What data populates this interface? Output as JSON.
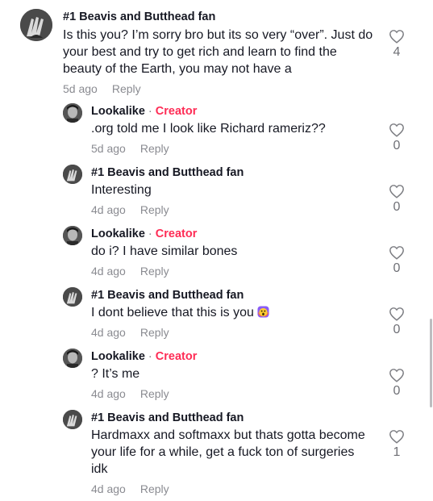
{
  "comments": [
    {
      "author": "#1 Beavis and Butthead fan",
      "is_creator": false,
      "text": "Is this you? I’m sorry bro but its so very “over”. Just do your best and try to get rich and learn to find the beauty of the Earth, you may not have a",
      "time": "5d ago",
      "reply_label": "Reply",
      "likes": "4",
      "avatar_icon": "fingers-avatar-icon"
    },
    {
      "author": "Lookalike",
      "is_creator": true,
      "separator": "·",
      "creator_label": "Creator",
      "text": ".org told me I look like Richard rameriz??",
      "time": "5d ago",
      "reply_label": "Reply",
      "likes": "0",
      "avatar_icon": "portrait-avatar-icon"
    },
    {
      "author": "#1 Beavis and Butthead fan",
      "is_creator": false,
      "text": "Interesting",
      "time": "4d ago",
      "reply_label": "Reply",
      "likes": "0",
      "avatar_icon": "fingers-avatar-icon"
    },
    {
      "author": "Lookalike",
      "is_creator": true,
      "separator": "·",
      "creator_label": "Creator",
      "text": "do i? I have similar bones",
      "time": "4d ago",
      "reply_label": "Reply",
      "likes": "0",
      "avatar_icon": "portrait-avatar-icon"
    },
    {
      "author": "#1 Beavis and Butthead fan",
      "is_creator": false,
      "text": "I dont believe that this is you",
      "emoji": "shocked-face-emoji",
      "time": "4d ago",
      "reply_label": "Reply",
      "likes": "0",
      "avatar_icon": "fingers-avatar-icon"
    },
    {
      "author": "Lookalike",
      "is_creator": true,
      "separator": "·",
      "creator_label": "Creator",
      "text": "? It’s me",
      "time": "4d ago",
      "reply_label": "Reply",
      "likes": "0",
      "avatar_icon": "portrait-avatar-icon"
    },
    {
      "author": "#1 Beavis and Butthead fan",
      "is_creator": false,
      "text": "Hardmaxx and softmaxx but thats gotta become your life for a while, get a fuck ton of surgeries idk",
      "time": "4d ago",
      "reply_label": "Reply",
      "likes": "1",
      "avatar_icon": "fingers-avatar-icon"
    }
  ],
  "colors": {
    "creator": "#fe2c55",
    "meta": "#8a8b91",
    "text": "#161823"
  }
}
